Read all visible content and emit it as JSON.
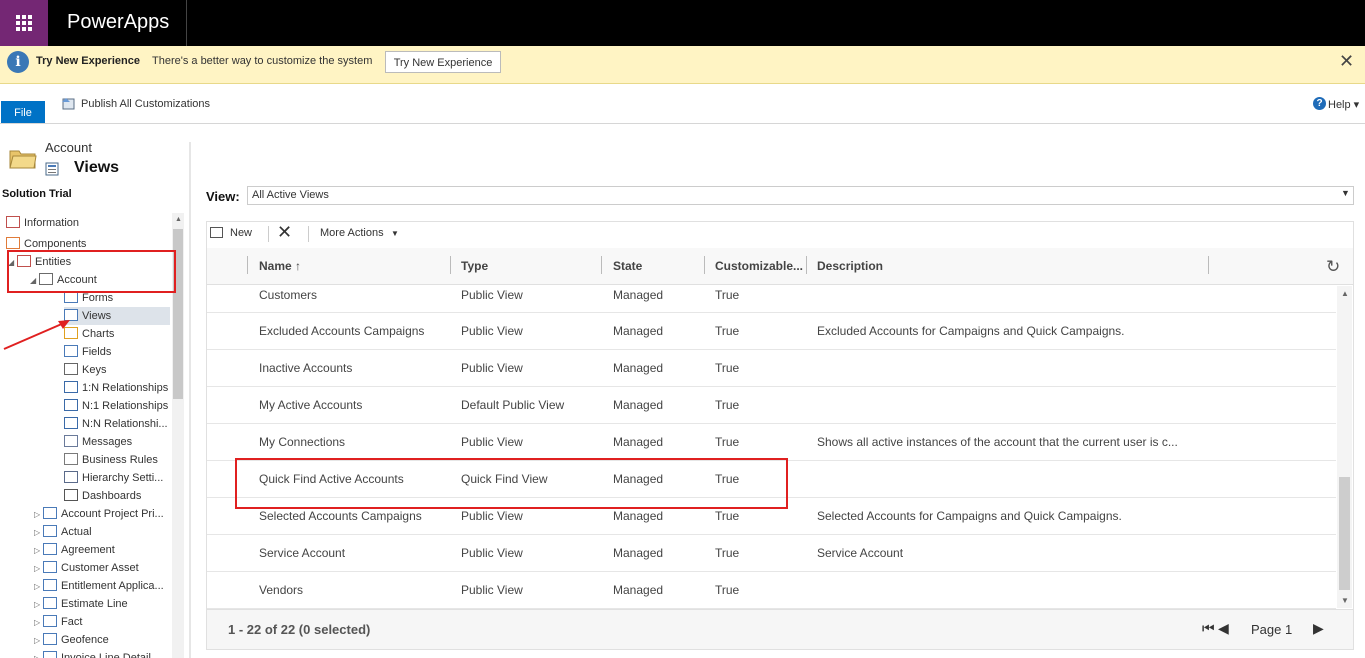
{
  "app": {
    "title": "PowerApps"
  },
  "notification": {
    "title": "Try New Experience",
    "message": "There's a better way to customize the system",
    "button_label": "Try New Experience",
    "close_glyph": "✕"
  },
  "ribbon": {
    "file_label": "File",
    "publish_label": "Publish All Customizations",
    "help_label": "Help ▾"
  },
  "left_panel": {
    "entity_name": "Account",
    "section_title": "Views",
    "solution_label": "Solution Trial",
    "tree": [
      {
        "label": "Information",
        "icon": "information-icon"
      },
      {
        "label": "Components",
        "icon": "components-icon"
      },
      {
        "label": "Entities",
        "icon": "entities-icon"
      },
      {
        "label": "Account",
        "icon": "entity-icon"
      },
      {
        "label": "Forms",
        "icon": "forms-icon"
      },
      {
        "label": "Views",
        "icon": "views-icon"
      },
      {
        "label": "Charts",
        "icon": "charts-icon"
      },
      {
        "label": "Fields",
        "icon": "fields-icon"
      },
      {
        "label": "Keys",
        "icon": "keys-icon"
      },
      {
        "label": "1:N Relationships",
        "icon": "relationship-icon"
      },
      {
        "label": "N:1 Relationships",
        "icon": "relationship-icon"
      },
      {
        "label": "N:N Relationshi...",
        "icon": "relationship-icon"
      },
      {
        "label": "Messages",
        "icon": "messages-icon"
      },
      {
        "label": "Business Rules",
        "icon": "business-rules-icon"
      },
      {
        "label": "Hierarchy Setti...",
        "icon": "hierarchy-icon"
      },
      {
        "label": "Dashboards",
        "icon": "dashboards-icon"
      },
      {
        "label": "Account Project Pri...",
        "icon": "entity-gear-icon"
      },
      {
        "label": "Actual",
        "icon": "entity-gear-icon"
      },
      {
        "label": "Agreement",
        "icon": "entity-gear-icon"
      },
      {
        "label": "Customer Asset",
        "icon": "entity-gear-icon"
      },
      {
        "label": "Entitlement Applica...",
        "icon": "entity-gear-icon"
      },
      {
        "label": "Estimate Line",
        "icon": "entity-gear-icon"
      },
      {
        "label": "Fact",
        "icon": "entity-gear-icon"
      },
      {
        "label": "Geofence",
        "icon": "entity-gear-icon"
      },
      {
        "label": "Invoice Line Detail",
        "icon": "entity-gear-icon"
      }
    ]
  },
  "main": {
    "view_label": "View:",
    "view_selected": "All Active Views",
    "commands": {
      "new_label": "New",
      "more_label": "More Actions"
    },
    "columns": [
      "Name ↑",
      "Type",
      "State",
      "Customizable...",
      "Description"
    ],
    "rows": [
      [
        "Customers",
        "Public View",
        "Managed",
        "True",
        ""
      ],
      [
        "Excluded Accounts Campaigns",
        "Public View",
        "Managed",
        "True",
        "Excluded Accounts for Campaigns and Quick Campaigns."
      ],
      [
        "Inactive Accounts",
        "Public View",
        "Managed",
        "True",
        ""
      ],
      [
        "My Active Accounts",
        "Default Public View",
        "Managed",
        "True",
        ""
      ],
      [
        "My Connections",
        "Public View",
        "Managed",
        "True",
        "Shows all active instances of the account that the current user is c..."
      ],
      [
        "Quick Find Active Accounts",
        "Quick Find View",
        "Managed",
        "True",
        ""
      ],
      [
        "Selected Accounts Campaigns",
        "Public View",
        "Managed",
        "True",
        "Selected Accounts for Campaigns and Quick Campaigns."
      ],
      [
        "Service Account",
        "Public View",
        "Managed",
        "True",
        "Service Account"
      ],
      [
        "Vendors",
        "Public View",
        "Managed",
        "True",
        ""
      ]
    ],
    "footer": {
      "record_count": "1 - 22 of 22 (0 selected)",
      "page_label": "Page 1"
    }
  },
  "colors": {
    "waffle": "#742774",
    "notification_bg": "#fff4c4",
    "file_button": "#0072c6",
    "highlight": "#e02020"
  }
}
